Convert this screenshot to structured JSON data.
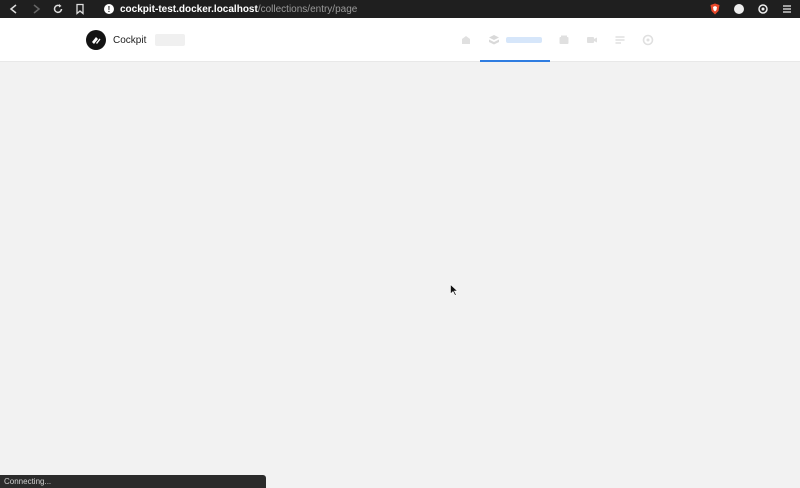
{
  "browser": {
    "url_host": "cockpit-test.docker.localhost",
    "url_path": "/collections/entry/page",
    "icons": [
      "back-icon",
      "forward-icon",
      "reload-icon",
      "bookmark-icon",
      "info-icon",
      "brave-shield-icon",
      "extension-icon",
      "puzzle-icon",
      "hamburger-menu-icon"
    ]
  },
  "header": {
    "brand_name": "Cockpit"
  },
  "menu": {
    "items": [
      "dashboard-icon",
      "collections-icon",
      "singletons-icon",
      "assets-icon",
      "forms-icon",
      "settings-icon"
    ],
    "active": "collections-icon"
  },
  "status": {
    "text": "Connecting..."
  },
  "colors": {
    "accent": "#2f7de1",
    "page_bg": "#f2f2f2",
    "chrome_bg": "#1f1f1f"
  }
}
